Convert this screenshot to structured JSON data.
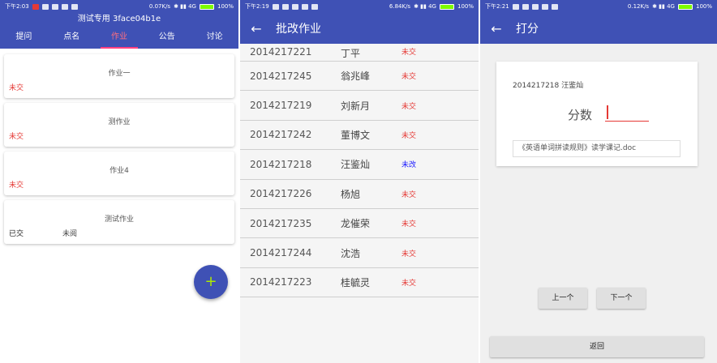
{
  "panel1": {
    "status_time": "下午2:03",
    "status_speed": "0.07K/s",
    "status_battery": "100%",
    "title": "测试专用 3face04b1e",
    "tabs": [
      "提问",
      "点名",
      "作业",
      "公告",
      "讨论"
    ],
    "active_tab": 2,
    "cards": [
      {
        "title": "作业一",
        "status": "未交",
        "read": ""
      },
      {
        "title": "测作业",
        "status": "未交",
        "read": ""
      },
      {
        "title": "作业4",
        "status": "未交",
        "read": ""
      },
      {
        "title": "测试作业",
        "status": "已交",
        "read": "未阅"
      }
    ],
    "fab_label": "+"
  },
  "panel2": {
    "status_time": "下午2:19",
    "status_speed": "6.84K/s",
    "status_battery": "100%",
    "back_icon": "←",
    "title": "批改作业",
    "rows": [
      {
        "id": "2014217221",
        "name": "丁平",
        "status": "未交"
      },
      {
        "id": "2014217245",
        "name": "翁兆峰",
        "status": "未交"
      },
      {
        "id": "2014217219",
        "name": "刘新月",
        "status": "未交"
      },
      {
        "id": "2014217242",
        "name": "董博文",
        "status": "未交"
      },
      {
        "id": "2014217218",
        "name": "汪鉴灿",
        "status": "未改"
      },
      {
        "id": "2014217226",
        "name": "杨旭",
        "status": "未交"
      },
      {
        "id": "2014217235",
        "name": "龙催荣",
        "status": "未交"
      },
      {
        "id": "2014217244",
        "name": "沈浩",
        "status": "未交"
      },
      {
        "id": "2014217223",
        "name": "桂毓灵",
        "status": "未交"
      }
    ],
    "status_colors": {
      "未交": "#e53935",
      "未改": "#1a1aff"
    }
  },
  "panel3": {
    "status_time": "下午2:21",
    "status_speed": "0.12K/s",
    "status_battery": "100%",
    "back_icon": "←",
    "title": "打分",
    "student": "2014217218 汪鉴灿",
    "score_label": "分数",
    "score_value": "",
    "file_name": "《英语单词拼读规则》读学课记.doc",
    "prev_label": "上一个",
    "next_label": "下一个",
    "return_label": "返回"
  },
  "colors": {
    "primary": "#3f51b5",
    "accent": "#ff4081",
    "fab_icon": "#aeea00"
  }
}
